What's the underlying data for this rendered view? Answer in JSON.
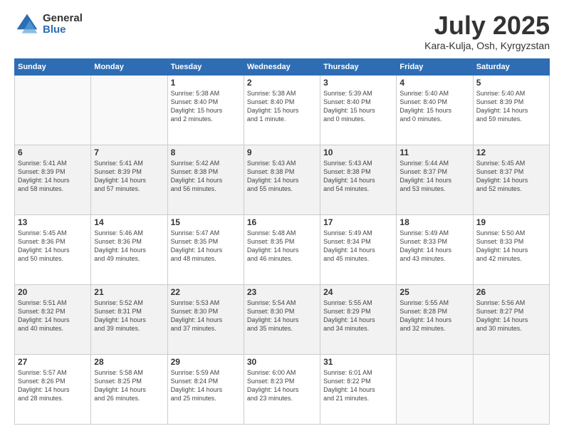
{
  "header": {
    "logo_general": "General",
    "logo_blue": "Blue",
    "title": "July 2025",
    "subtitle": "Kara-Kulja, Osh, Kyrgyzstan"
  },
  "days_of_week": [
    "Sunday",
    "Monday",
    "Tuesday",
    "Wednesday",
    "Thursday",
    "Friday",
    "Saturday"
  ],
  "weeks": [
    [
      {
        "day": "",
        "info": ""
      },
      {
        "day": "",
        "info": ""
      },
      {
        "day": "1",
        "info": "Sunrise: 5:38 AM\nSunset: 8:40 PM\nDaylight: 15 hours\nand 2 minutes."
      },
      {
        "day": "2",
        "info": "Sunrise: 5:38 AM\nSunset: 8:40 PM\nDaylight: 15 hours\nand 1 minute."
      },
      {
        "day": "3",
        "info": "Sunrise: 5:39 AM\nSunset: 8:40 PM\nDaylight: 15 hours\nand 0 minutes."
      },
      {
        "day": "4",
        "info": "Sunrise: 5:40 AM\nSunset: 8:40 PM\nDaylight: 15 hours\nand 0 minutes."
      },
      {
        "day": "5",
        "info": "Sunrise: 5:40 AM\nSunset: 8:39 PM\nDaylight: 14 hours\nand 59 minutes."
      }
    ],
    [
      {
        "day": "6",
        "info": "Sunrise: 5:41 AM\nSunset: 8:39 PM\nDaylight: 14 hours\nand 58 minutes."
      },
      {
        "day": "7",
        "info": "Sunrise: 5:41 AM\nSunset: 8:39 PM\nDaylight: 14 hours\nand 57 minutes."
      },
      {
        "day": "8",
        "info": "Sunrise: 5:42 AM\nSunset: 8:38 PM\nDaylight: 14 hours\nand 56 minutes."
      },
      {
        "day": "9",
        "info": "Sunrise: 5:43 AM\nSunset: 8:38 PM\nDaylight: 14 hours\nand 55 minutes."
      },
      {
        "day": "10",
        "info": "Sunrise: 5:43 AM\nSunset: 8:38 PM\nDaylight: 14 hours\nand 54 minutes."
      },
      {
        "day": "11",
        "info": "Sunrise: 5:44 AM\nSunset: 8:37 PM\nDaylight: 14 hours\nand 53 minutes."
      },
      {
        "day": "12",
        "info": "Sunrise: 5:45 AM\nSunset: 8:37 PM\nDaylight: 14 hours\nand 52 minutes."
      }
    ],
    [
      {
        "day": "13",
        "info": "Sunrise: 5:45 AM\nSunset: 8:36 PM\nDaylight: 14 hours\nand 50 minutes."
      },
      {
        "day": "14",
        "info": "Sunrise: 5:46 AM\nSunset: 8:36 PM\nDaylight: 14 hours\nand 49 minutes."
      },
      {
        "day": "15",
        "info": "Sunrise: 5:47 AM\nSunset: 8:35 PM\nDaylight: 14 hours\nand 48 minutes."
      },
      {
        "day": "16",
        "info": "Sunrise: 5:48 AM\nSunset: 8:35 PM\nDaylight: 14 hours\nand 46 minutes."
      },
      {
        "day": "17",
        "info": "Sunrise: 5:49 AM\nSunset: 8:34 PM\nDaylight: 14 hours\nand 45 minutes."
      },
      {
        "day": "18",
        "info": "Sunrise: 5:49 AM\nSunset: 8:33 PM\nDaylight: 14 hours\nand 43 minutes."
      },
      {
        "day": "19",
        "info": "Sunrise: 5:50 AM\nSunset: 8:33 PM\nDaylight: 14 hours\nand 42 minutes."
      }
    ],
    [
      {
        "day": "20",
        "info": "Sunrise: 5:51 AM\nSunset: 8:32 PM\nDaylight: 14 hours\nand 40 minutes."
      },
      {
        "day": "21",
        "info": "Sunrise: 5:52 AM\nSunset: 8:31 PM\nDaylight: 14 hours\nand 39 minutes."
      },
      {
        "day": "22",
        "info": "Sunrise: 5:53 AM\nSunset: 8:30 PM\nDaylight: 14 hours\nand 37 minutes."
      },
      {
        "day": "23",
        "info": "Sunrise: 5:54 AM\nSunset: 8:30 PM\nDaylight: 14 hours\nand 35 minutes."
      },
      {
        "day": "24",
        "info": "Sunrise: 5:55 AM\nSunset: 8:29 PM\nDaylight: 14 hours\nand 34 minutes."
      },
      {
        "day": "25",
        "info": "Sunrise: 5:55 AM\nSunset: 8:28 PM\nDaylight: 14 hours\nand 32 minutes."
      },
      {
        "day": "26",
        "info": "Sunrise: 5:56 AM\nSunset: 8:27 PM\nDaylight: 14 hours\nand 30 minutes."
      }
    ],
    [
      {
        "day": "27",
        "info": "Sunrise: 5:57 AM\nSunset: 8:26 PM\nDaylight: 14 hours\nand 28 minutes."
      },
      {
        "day": "28",
        "info": "Sunrise: 5:58 AM\nSunset: 8:25 PM\nDaylight: 14 hours\nand 26 minutes."
      },
      {
        "day": "29",
        "info": "Sunrise: 5:59 AM\nSunset: 8:24 PM\nDaylight: 14 hours\nand 25 minutes."
      },
      {
        "day": "30",
        "info": "Sunrise: 6:00 AM\nSunset: 8:23 PM\nDaylight: 14 hours\nand 23 minutes."
      },
      {
        "day": "31",
        "info": "Sunrise: 6:01 AM\nSunset: 8:22 PM\nDaylight: 14 hours\nand 21 minutes."
      },
      {
        "day": "",
        "info": ""
      },
      {
        "day": "",
        "info": ""
      }
    ]
  ]
}
